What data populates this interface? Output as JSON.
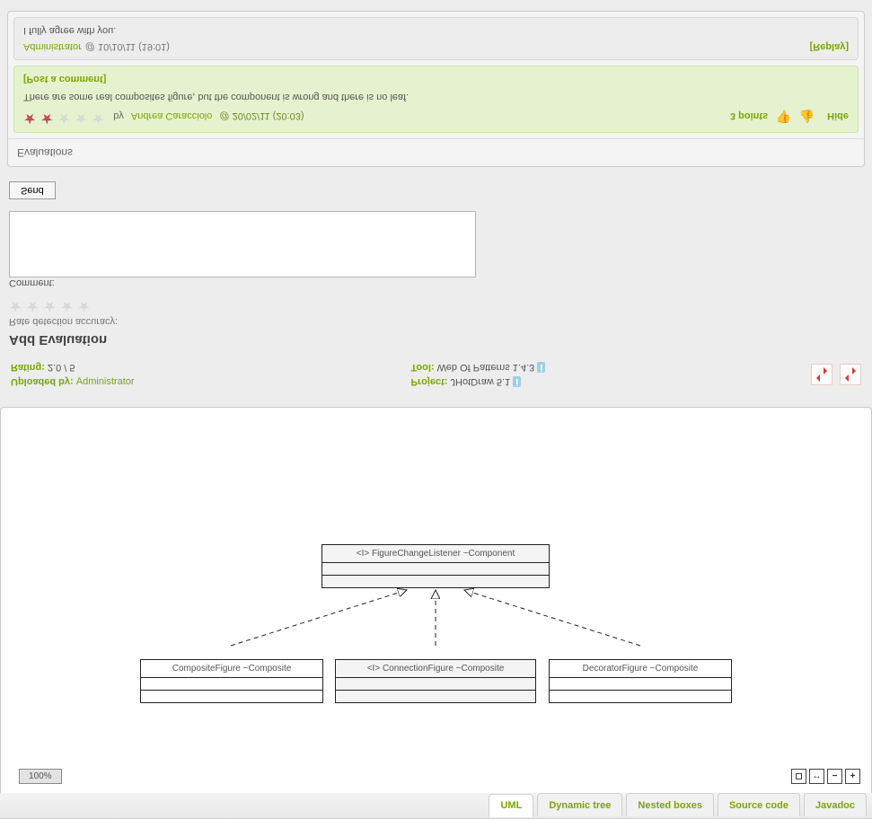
{
  "tabs": {
    "items": [
      {
        "label": "UML"
      },
      {
        "label": "Dynamic tree"
      },
      {
        "label": "Nested boxes"
      },
      {
        "label": "Source code"
      },
      {
        "label": "Javadoc"
      }
    ],
    "active_index": 0
  },
  "diagram": {
    "zoom_label": "100%",
    "controls": {
      "fit": "◻",
      "w": "↔",
      "minus": "−",
      "plus": "+"
    },
    "classes": {
      "top_left": "CompositeFigure ~Composite",
      "top_mid": "<I> ConnectionFigure ~Composite",
      "top_right": "DecoratorFigure ~Composite",
      "bottom": "<I> FigureChangeListener ~Component"
    }
  },
  "meta": {
    "uploaded_by_label": "Uploaded by:",
    "uploaded_by_value": "Administrator",
    "rating_label": "Rating:",
    "rating_value": "2.0 / 5",
    "project_label": "Project:",
    "project_value": "JHotDraw 5.1",
    "tool_label": "Tool:",
    "tool_value": "Web Of Patterns 1.4.3"
  },
  "add_evaluation": {
    "heading": "Add Evaluation",
    "rate_label": "Rate detection accuracy:",
    "comment_label": "Comment:",
    "send_label": "Send"
  },
  "evaluations": {
    "header": "Evaluations",
    "items": [
      {
        "by_prefix": "by",
        "author": "Andrea Caracciolo",
        "at": "@ 20/02/11 (20:03)",
        "points_label": "3 points",
        "hide_label": "Hide",
        "body": "There are some real composites figure, but the component is wrong and there is no leaf.",
        "post_comment_label": "[Post a comment]",
        "replies": [
          {
            "author": "Administrator",
            "at": "@ 10/10/11 (19:01)",
            "reply_label": "[Replay]",
            "body": "I fully agree with you."
          }
        ]
      }
    ]
  }
}
